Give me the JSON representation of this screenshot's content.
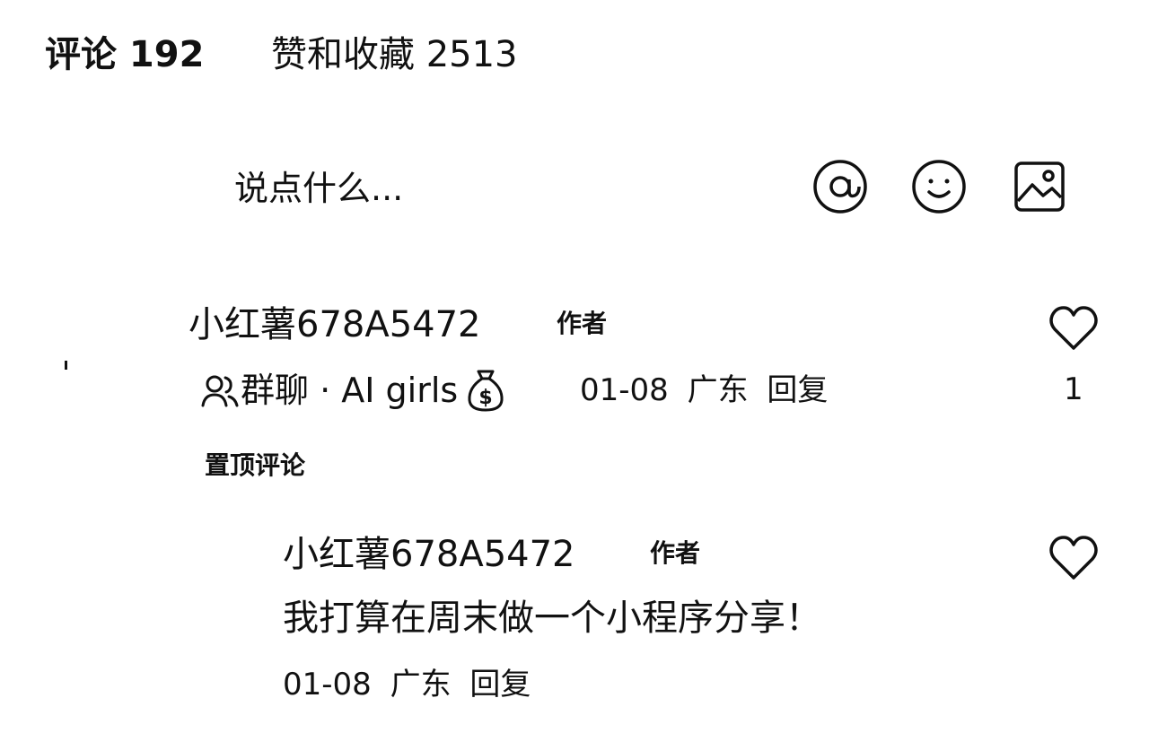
{
  "tabs": {
    "comments_label": "评论 192",
    "likes_label": "赞和收藏 2513"
  },
  "input": {
    "placeholder": "说点什么..."
  },
  "icons": {
    "mention": "at-icon",
    "emoji": "smiley-icon",
    "image": "image-icon",
    "like": "heart-icon",
    "group": "people-icon",
    "money_bag": "money-bag-icon"
  },
  "comments": [
    {
      "username": "小红薯678A5472",
      "author_tag": "作者",
      "group_text": "群聊 · AI girls",
      "date": "01-08",
      "location": "广东",
      "reply_label": "回复",
      "like_count": "1",
      "pinned_label": "置顶评论"
    }
  ],
  "replies": [
    {
      "username": "小红薯678A5472",
      "author_tag": "作者",
      "content": "我打算在周末做一个小程序分享！",
      "date": "01-08",
      "location": "广东",
      "reply_label": "回复"
    }
  ]
}
